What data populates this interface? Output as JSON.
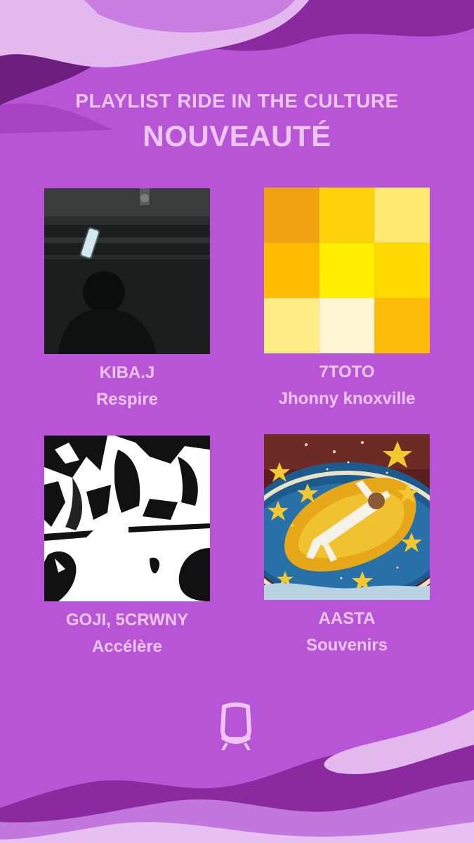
{
  "header": {
    "subtitle": "PLAYLIST RIDE IN THE CULTURE",
    "title": "NOUVEAUTÉ"
  },
  "tracks": [
    {
      "artist": "KIBA.J",
      "title": "Respire",
      "cover": "dark-photo-cover"
    },
    {
      "artist": "7TOTO",
      "title": "Jhonny knoxville",
      "cover": "yellow-grid-cover"
    },
    {
      "artist": "GOJI, 5CRWNY",
      "title": "Accélère",
      "cover": "manga-panels-cover"
    },
    {
      "artist": "AASTA",
      "title": "Souvenirs",
      "cover": "starry-float-cover"
    }
  ],
  "colors": {
    "background": "#b855d6",
    "text": "#ecc6f6",
    "wave_dark": "#8a2a9e",
    "wave_light": "#e3b8ef"
  },
  "logo": {
    "icon": "tram-logo-icon"
  }
}
